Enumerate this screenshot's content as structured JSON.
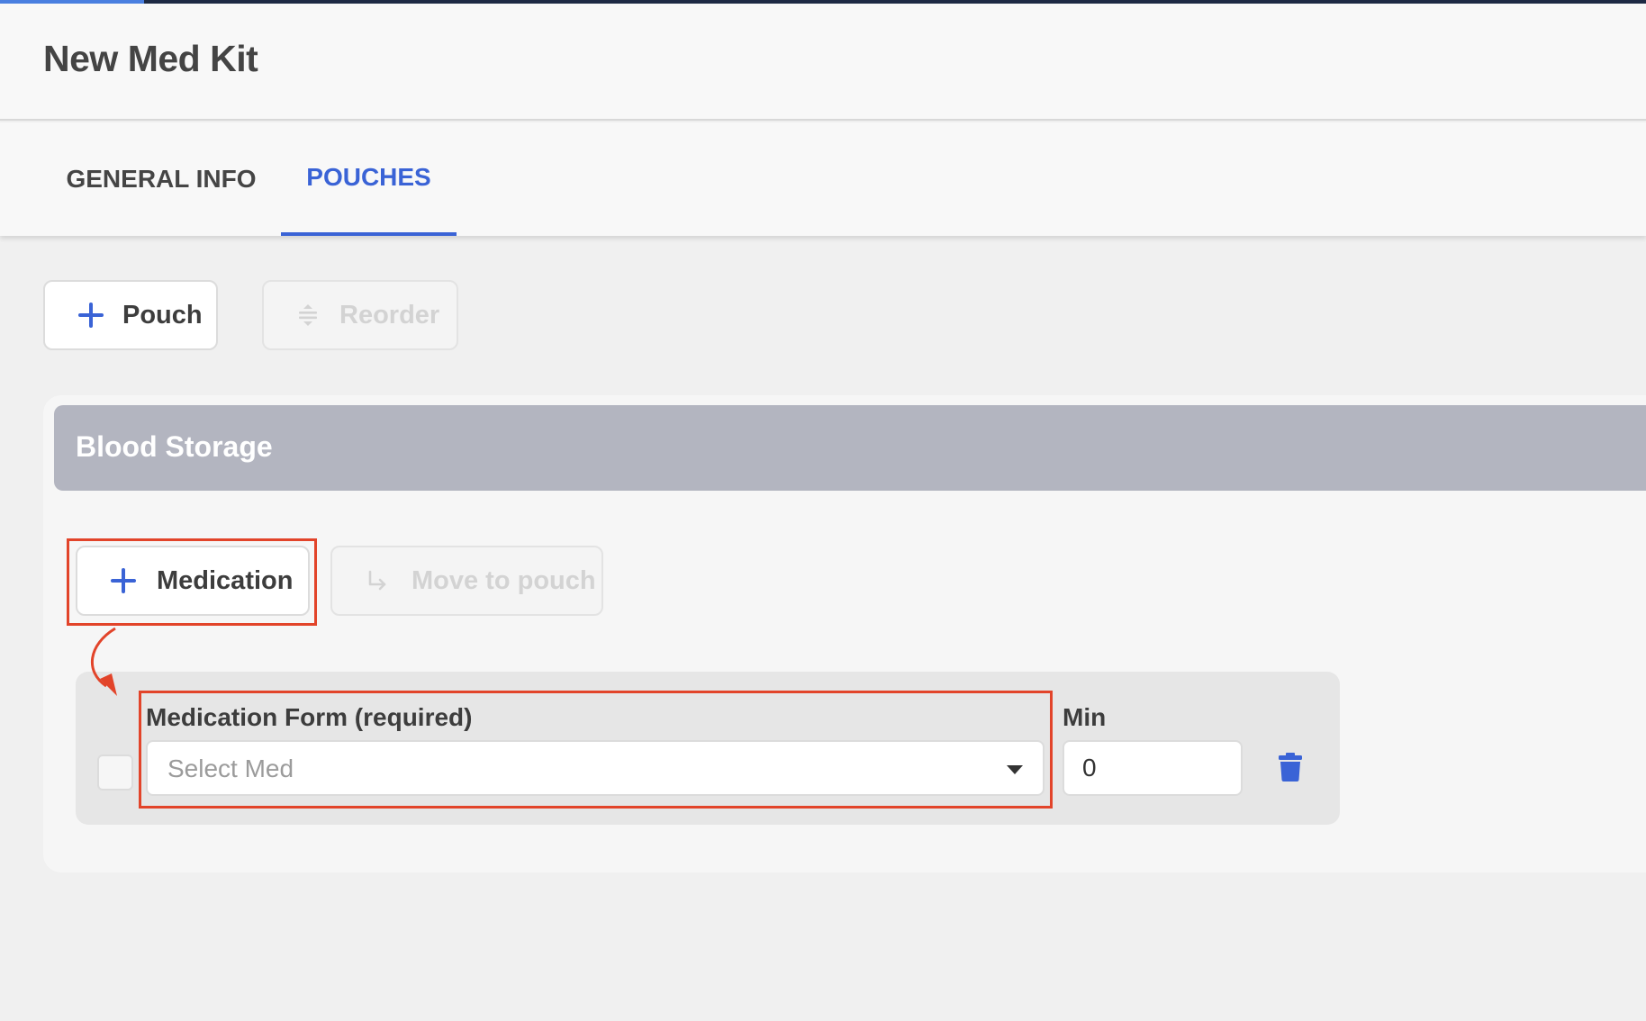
{
  "colors": {
    "accent": "#3a63d6",
    "annotation": "#e2442a",
    "pouch_header": "#b3b5c0"
  },
  "header": {
    "title": "New Med Kit"
  },
  "tabs": [
    {
      "label": "GENERAL INFO",
      "active": false
    },
    {
      "label": "POUCHES",
      "active": true
    }
  ],
  "toolbar": {
    "add_pouch_label": "Pouch",
    "add_pouch_icon": "plus-icon",
    "reorder_label": "Reorder",
    "reorder_icon": "reorder-icon"
  },
  "pouch": {
    "title": "Blood Storage",
    "add_medication_label": "Medication",
    "add_medication_icon": "plus-icon",
    "move_label": "Move to pouch",
    "move_icon": "arrow-down-right-icon",
    "medication_row": {
      "form_label": "Medication Form (required)",
      "form_placeholder": "Select Med",
      "min_label": "Min",
      "min_value": "0",
      "delete_icon": "trash-icon"
    }
  }
}
